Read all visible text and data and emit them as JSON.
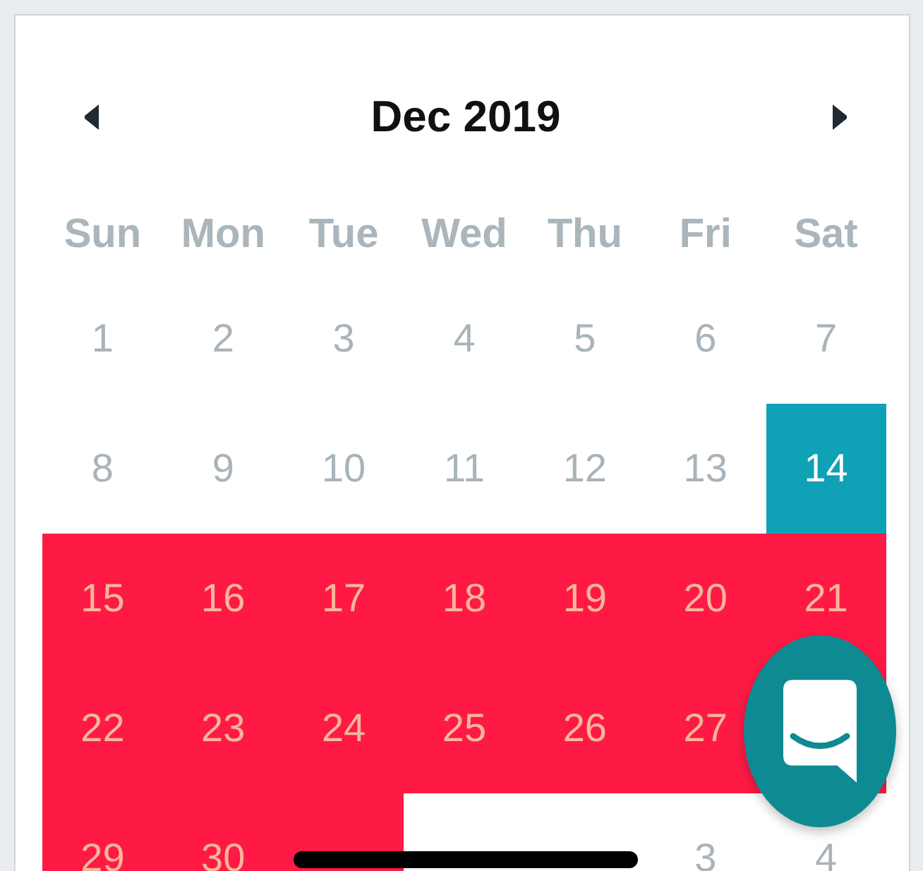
{
  "calendar": {
    "title": "Dec 2019",
    "weekdays": [
      "Sun",
      "Mon",
      "Tue",
      "Wed",
      "Thu",
      "Fri",
      "Sat"
    ],
    "weeks": [
      [
        {
          "label": "1",
          "selected": false,
          "in_range": false
        },
        {
          "label": "2",
          "selected": false,
          "in_range": false
        },
        {
          "label": "3",
          "selected": false,
          "in_range": false
        },
        {
          "label": "4",
          "selected": false,
          "in_range": false
        },
        {
          "label": "5",
          "selected": false,
          "in_range": false
        },
        {
          "label": "6",
          "selected": false,
          "in_range": false
        },
        {
          "label": "7",
          "selected": false,
          "in_range": false
        }
      ],
      [
        {
          "label": "8",
          "selected": false,
          "in_range": false
        },
        {
          "label": "9",
          "selected": false,
          "in_range": false
        },
        {
          "label": "10",
          "selected": false,
          "in_range": false
        },
        {
          "label": "11",
          "selected": false,
          "in_range": false
        },
        {
          "label": "12",
          "selected": false,
          "in_range": false
        },
        {
          "label": "13",
          "selected": false,
          "in_range": false
        },
        {
          "label": "14",
          "selected": true,
          "in_range": false
        }
      ],
      [
        {
          "label": "15",
          "selected": false,
          "in_range": true
        },
        {
          "label": "16",
          "selected": false,
          "in_range": true
        },
        {
          "label": "17",
          "selected": false,
          "in_range": true
        },
        {
          "label": "18",
          "selected": false,
          "in_range": true
        },
        {
          "label": "19",
          "selected": false,
          "in_range": true
        },
        {
          "label": "20",
          "selected": false,
          "in_range": true
        },
        {
          "label": "21",
          "selected": false,
          "in_range": true
        }
      ],
      [
        {
          "label": "22",
          "selected": false,
          "in_range": true
        },
        {
          "label": "23",
          "selected": false,
          "in_range": true
        },
        {
          "label": "24",
          "selected": false,
          "in_range": true
        },
        {
          "label": "25",
          "selected": false,
          "in_range": true
        },
        {
          "label": "26",
          "selected": false,
          "in_range": true
        },
        {
          "label": "27",
          "selected": false,
          "in_range": true
        },
        {
          "selected": false,
          "in_range": true
        }
      ],
      [
        {
          "label": "29",
          "selected": false,
          "in_range": true
        },
        {
          "label": "30",
          "selected": false,
          "in_range": true
        },
        {
          "selected": false,
          "in_range": true
        },
        {
          "selected": false,
          "in_range": false
        },
        {
          "selected": false,
          "in_range": false
        },
        {
          "label": "3",
          "selected": false,
          "in_range": false
        },
        {
          "label": "4",
          "selected": false,
          "in_range": false
        }
      ]
    ]
  }
}
